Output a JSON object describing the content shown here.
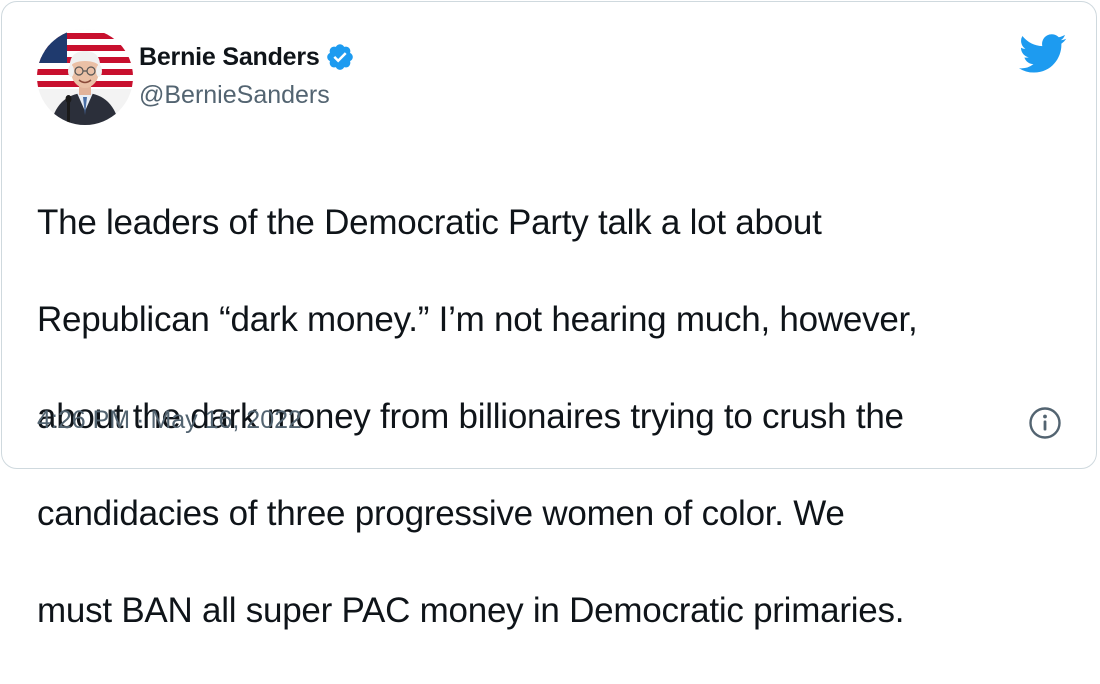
{
  "author": {
    "display_name": "Bernie Sanders",
    "handle": "@BernieSanders",
    "verified": true
  },
  "tweet": {
    "text_lines": [
      "The leaders of the Democratic Party talk a lot about",
      "Republican “dark money.” I’m not hearing much, however,",
      "about the dark money from billionaires trying to crush the",
      "candidacies of three progressive women of color. We",
      "must BAN all super PAC money in Democratic primaries."
    ]
  },
  "meta": {
    "time": "4:26 PM",
    "separator": "·",
    "date": "May 16, 2022"
  },
  "icons": {
    "verified": "verified-badge-icon",
    "brand": "twitter-bird-icon",
    "info": "info-icon"
  },
  "colors": {
    "brand_blue": "#1d9bf0",
    "text_primary": "#0f1419",
    "text_secondary": "#536471",
    "border": "#cfd9de"
  }
}
